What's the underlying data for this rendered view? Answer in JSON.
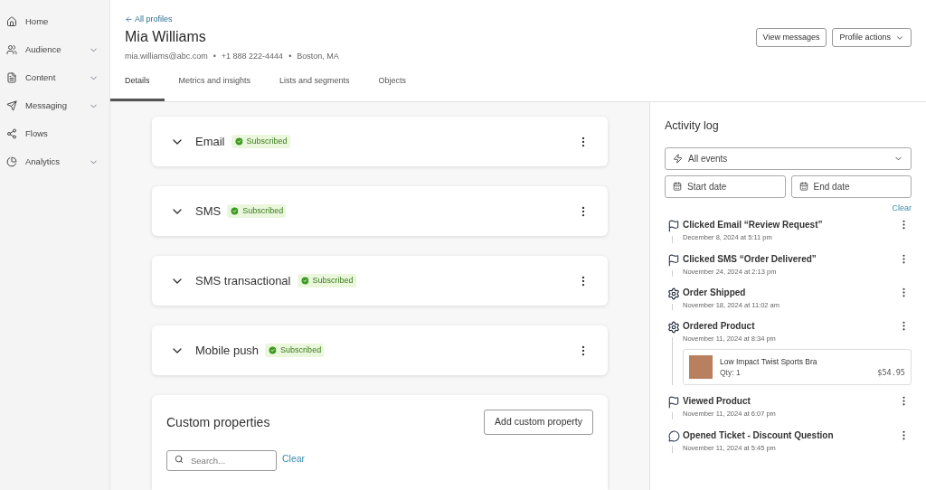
{
  "sidebar": {
    "items": [
      {
        "label": "Home",
        "expandable": false
      },
      {
        "label": "Audience",
        "expandable": true
      },
      {
        "label": "Content",
        "expandable": true
      },
      {
        "label": "Messaging",
        "expandable": true
      },
      {
        "label": "Flows",
        "expandable": false
      },
      {
        "label": "Analytics",
        "expandable": true
      }
    ]
  },
  "profile": {
    "back_link": "All profiles",
    "name": "Mia Williams",
    "email": "mia.williams@abc.com",
    "phone": "+1 888 222-4444",
    "location": "Boston, MA",
    "separator": "•"
  },
  "actions": {
    "view_messages": "View messages",
    "profile_actions": "Profile actions"
  },
  "tabs": [
    {
      "label": "Details",
      "selected": true
    },
    {
      "label": "Metrics and insights",
      "selected": false
    },
    {
      "label": "Lists and segments",
      "selected": false
    },
    {
      "label": "Objects",
      "selected": false
    }
  ],
  "channels": [
    {
      "name": "Email",
      "status": "Subscribed"
    },
    {
      "name": "SMS",
      "status": "Subscribed"
    },
    {
      "name": "SMS transactional",
      "status": "Subscribed"
    },
    {
      "name": "Mobile push",
      "status": "Subscribed"
    }
  ],
  "custom_properties": {
    "title": "Custom properties",
    "add_button": "Add custom property",
    "search_placeholder": "Search...",
    "clear": "Clear"
  },
  "activity_log": {
    "title": "Activity log",
    "filter": "All events",
    "start_date": "Start date",
    "end_date": "End date",
    "clear": "Clear",
    "events": [
      {
        "kind": "click",
        "title": "Clicked Email “Review Request”",
        "time": "December 8, 2024 at 5:11 pm"
      },
      {
        "kind": "click",
        "title": "Clicked SMS “Order Delivered”",
        "time": "November 24, 2024 at 2:13 pm"
      },
      {
        "kind": "system",
        "title": "Order Shipped",
        "time": "November 18, 2024 at 11:02 am"
      },
      {
        "kind": "system",
        "title": "Ordered Product",
        "time": "November 11, 2024 at 8:34 pm",
        "product": {
          "name": "Low Impact Twist Sports Bra",
          "qty": "Qty: 1",
          "price": "$54.95"
        }
      },
      {
        "kind": "click",
        "title": "Viewed Product",
        "time": "November 11, 2024 at 6:07 pm"
      },
      {
        "kind": "ticket",
        "title": "Opened Ticket - Discount Question",
        "time": "November 11, 2024 at 5:45 pm"
      }
    ]
  }
}
